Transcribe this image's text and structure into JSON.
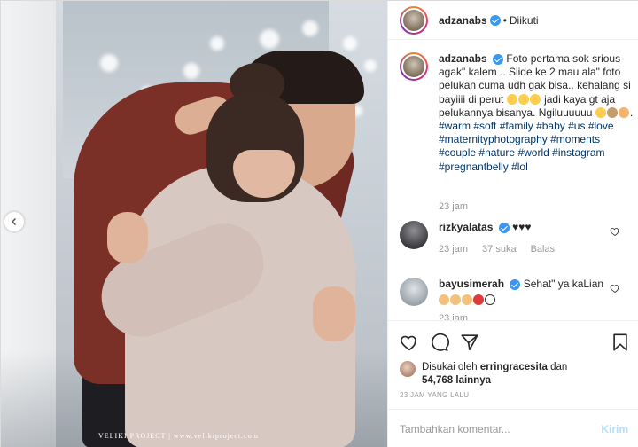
{
  "header": {
    "username": "adzanabs",
    "separator": "•",
    "follow_status": "Diikuti"
  },
  "photo": {
    "watermark": "VELIKI PROJECT | www.velikiproject.com"
  },
  "caption": {
    "username": "adzanabs",
    "lines": [
      "Foto pertama sok srious",
      "agak\" kalem .. Slide ke 2 mau ala\" foto",
      "pelukan cuma udh gak bisa.. kehalang",
      "si bayiiii di perut",
      "jadi kaya gt",
      "aja pelukannya bisanya. Ngiluuuuuu"
    ],
    "hashtags": [
      "#warm",
      "#soft",
      "#family",
      "#baby",
      "#us",
      "#love",
      "#maternityphotography",
      "#moments",
      "#couple",
      "#nature",
      "#world",
      "#instagram",
      "#pregnantbelly",
      "#lol"
    ],
    "time": "23 jam"
  },
  "comments": [
    {
      "username": "rizkyalatas",
      "text": "♥♥♥",
      "time": "23 jam",
      "likes": "37 suka",
      "reply": "Balas"
    },
    {
      "username": "bayusimerah",
      "text": "Sehat\" ya kaLian",
      "time": "23 jam"
    }
  ],
  "likes": {
    "prefix": "Disukai oleh",
    "user": "erringracesita",
    "conjunction": "dan",
    "count": "54,768 lainnya"
  },
  "date": "23 JAM YANG LALU",
  "comment_box": {
    "placeholder": "Tambahkan komentar...",
    "post_label": "Kirim"
  },
  "colors": {
    "verified": "#3897f0",
    "hashtag": "#003569",
    "muted": "#999999",
    "post_disabled": "#b2dffc",
    "heart": "#ed4956"
  },
  "icons": [
    "heart-icon",
    "comment-icon",
    "share-icon",
    "bookmark-icon",
    "verified-icon",
    "chevron-left-icon"
  ]
}
